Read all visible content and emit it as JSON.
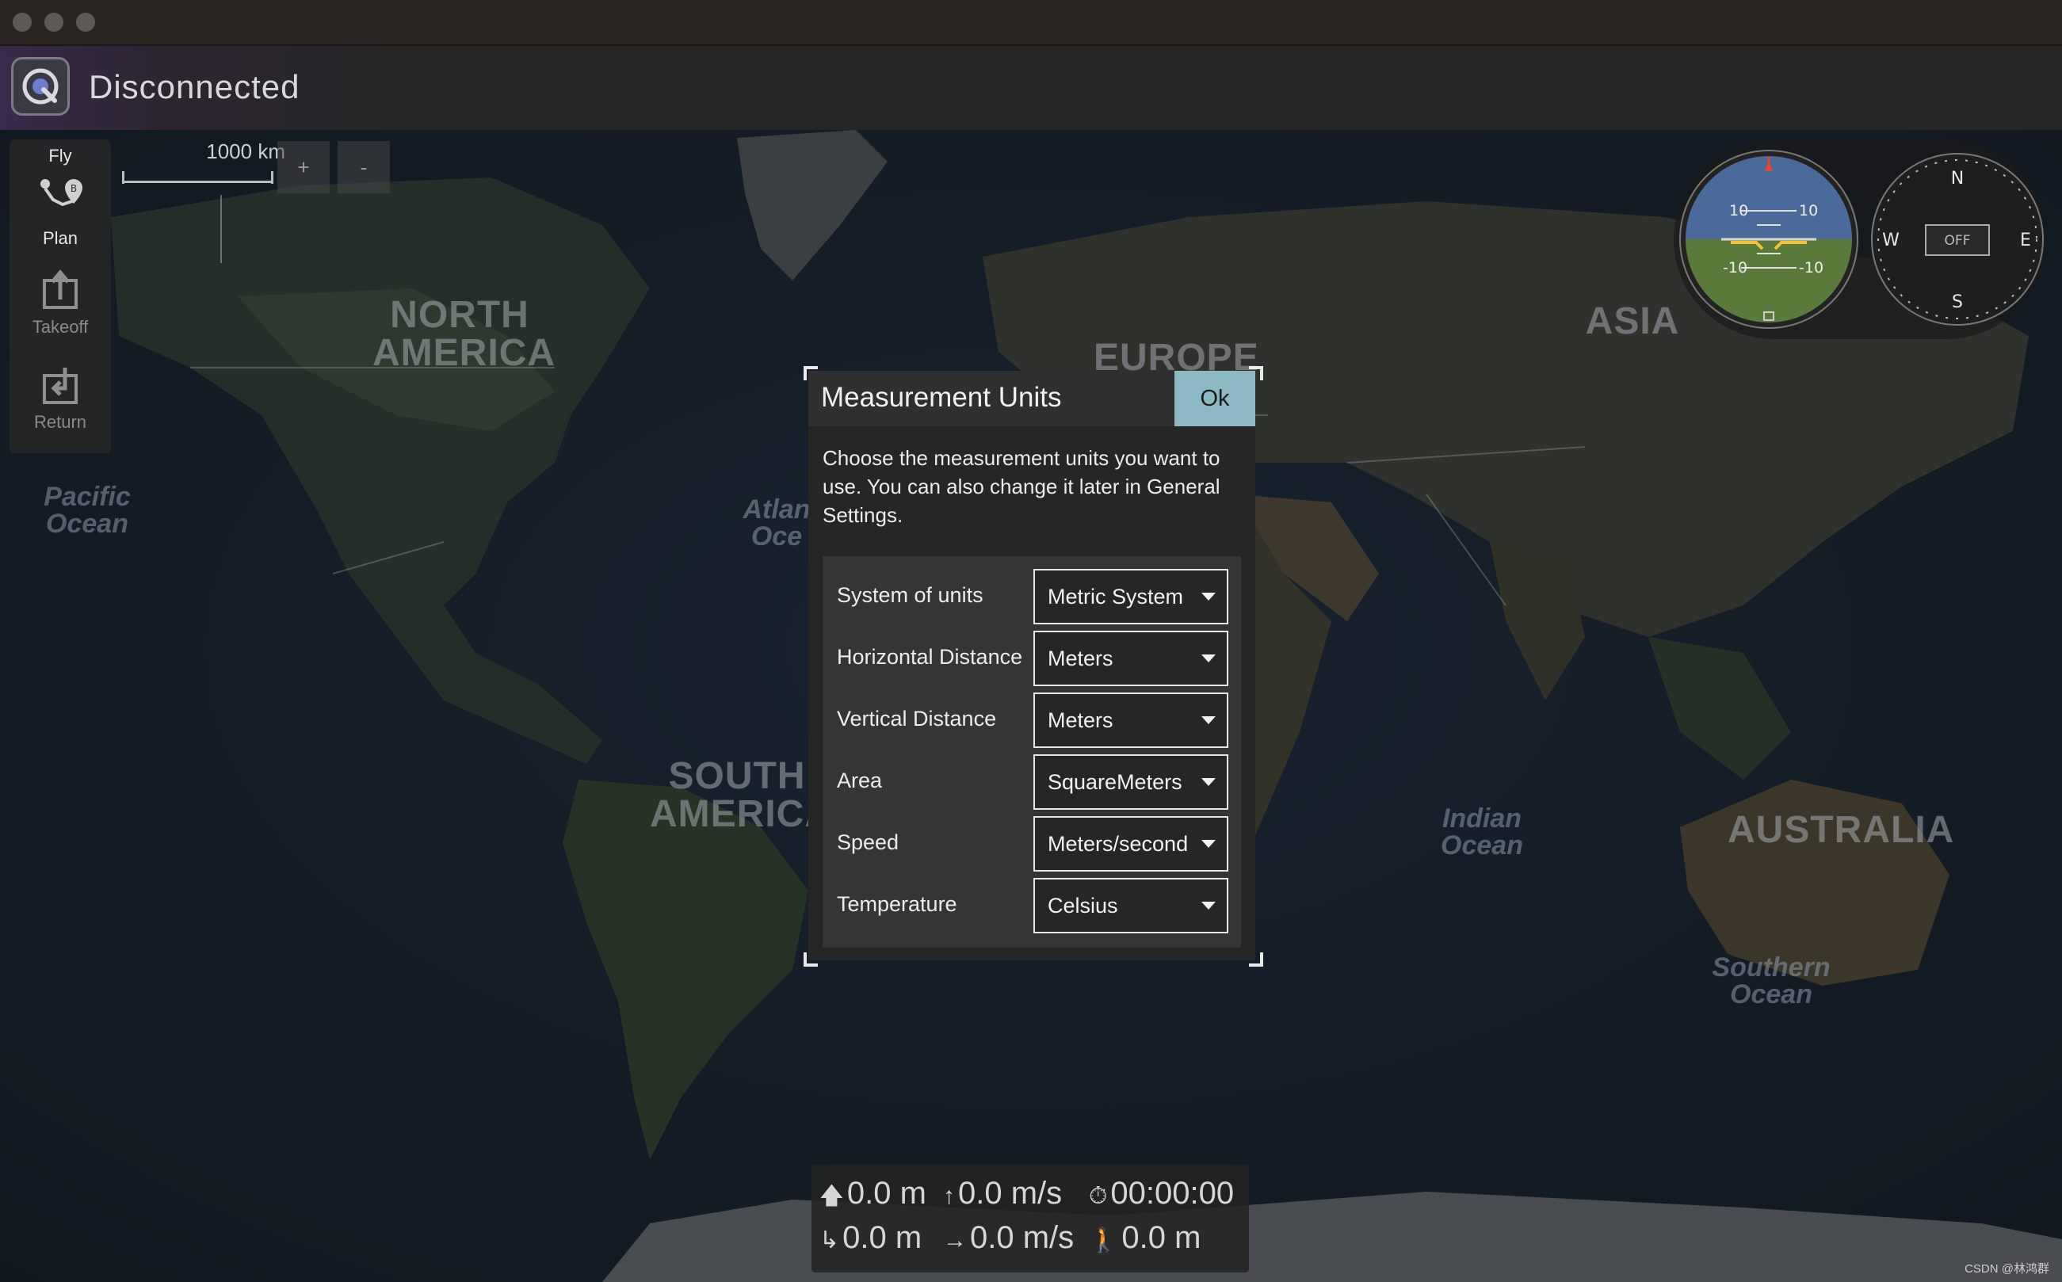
{
  "window": {
    "status": "Disconnected"
  },
  "toolstrip": {
    "fly": "Fly",
    "plan": "Plan",
    "takeoff": "Takeoff",
    "return": "Return"
  },
  "map": {
    "scale": "1000 km",
    "zoom_in": "+",
    "zoom_out": "-",
    "labels": {
      "north_america": "NORTH\nAMERICA",
      "south_america": "SOUTH\nAMERICA",
      "europe": "EUROPE",
      "asia": "ASIA",
      "australia": "AUSTRALIA",
      "pacific": "Pacific\nOcean",
      "atlantic": "Atlan\nOce",
      "indian": "Indian\nOcean",
      "southern": "Southern\nOcean"
    }
  },
  "instruments": {
    "attitude": {
      "pitch_up": "10",
      "pitch_down": "-10"
    },
    "compass": {
      "n": "N",
      "e": "E",
      "s": "S",
      "w": "W",
      "status": "OFF"
    }
  },
  "dialog": {
    "title": "Measurement Units",
    "ok": "Ok",
    "description": "Choose the measurement units you want to use. You can also change it later in General Settings.",
    "rows": [
      {
        "label": "System of units",
        "value": "Metric System"
      },
      {
        "label": "Horizontal Distance",
        "value": "Meters"
      },
      {
        "label": "Vertical Distance",
        "value": "Meters"
      },
      {
        "label": "Area",
        "value": "SquareMeters"
      },
      {
        "label": "Speed",
        "value": "Meters/second"
      },
      {
        "label": "Temperature",
        "value": "Celsius"
      }
    ]
  },
  "telemetry": {
    "altitude": "0.0 m",
    "climb_rate": "0.0 m/s",
    "flight_time": "00:00:00",
    "distance": "0.0 m",
    "ground_speed": "0.0 m/s",
    "home_distance": "0.0 m"
  },
  "credit": "CSDN @林鸿群"
}
